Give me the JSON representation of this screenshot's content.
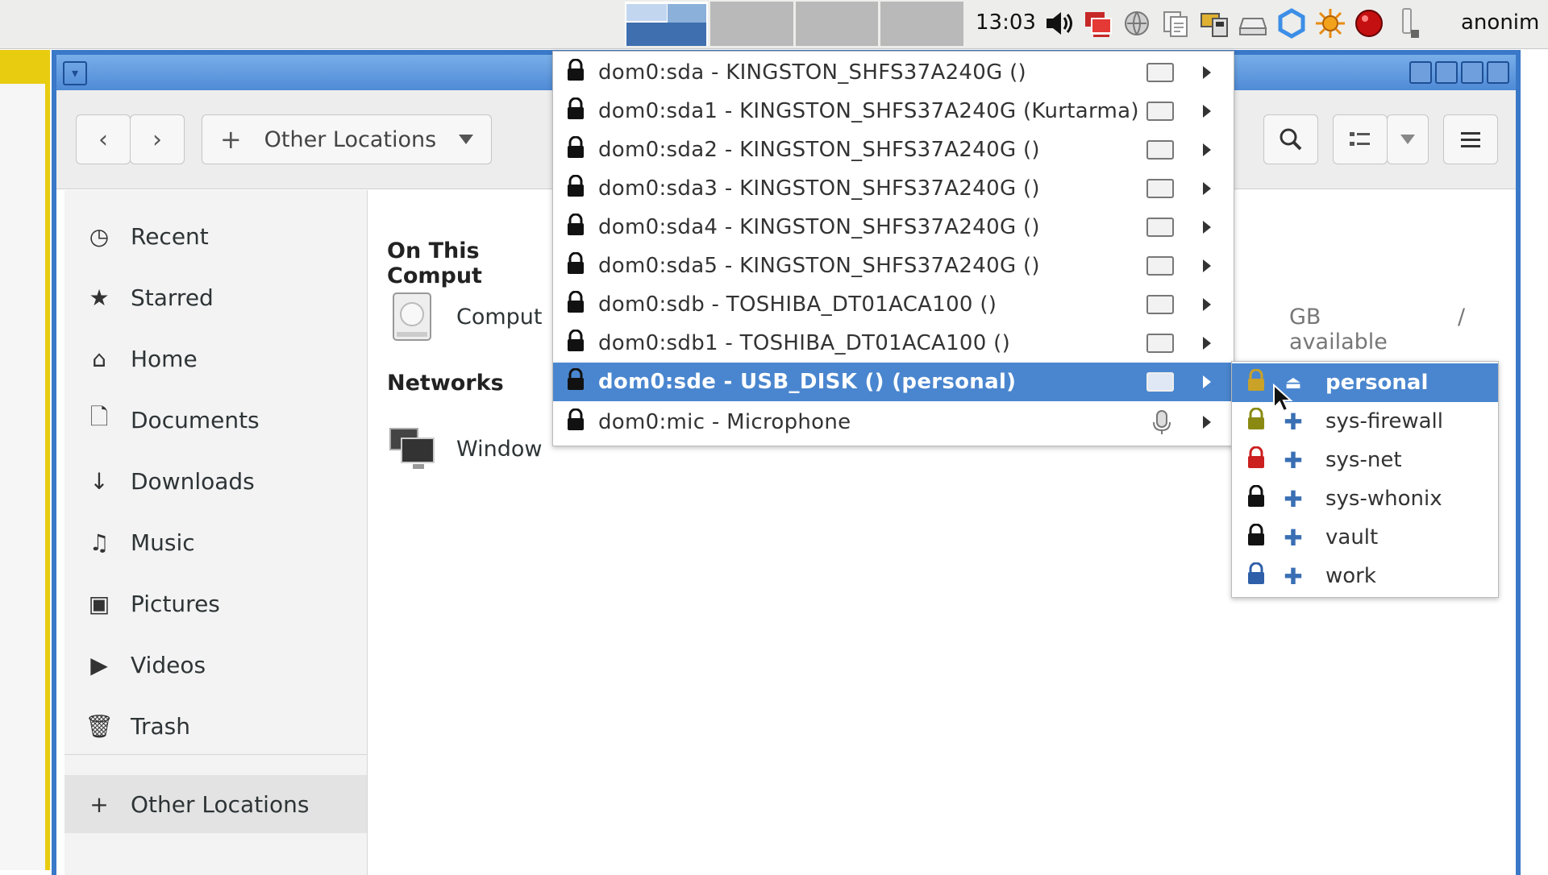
{
  "panel": {
    "clock": "13:03",
    "username": "anonim",
    "tray_icons": [
      "volume-icon",
      "qubes-domains-icon",
      "network-icon",
      "clipboard-icon",
      "devices-icon",
      "disk-icon",
      "updates-icon",
      "settings-sun-icon",
      "record-icon",
      "usb-icon"
    ]
  },
  "window": {
    "pathbar_label": "Other Locations"
  },
  "sidebar": {
    "items": [
      {
        "label": "Recent",
        "icon": "clock-icon"
      },
      {
        "label": "Starred",
        "icon": "star-icon"
      },
      {
        "label": "Home",
        "icon": "home-icon"
      },
      {
        "label": "Documents",
        "icon": "document-icon"
      },
      {
        "label": "Downloads",
        "icon": "download-icon"
      },
      {
        "label": "Music",
        "icon": "music-icon"
      },
      {
        "label": "Pictures",
        "icon": "camera-icon"
      },
      {
        "label": "Videos",
        "icon": "video-icon"
      },
      {
        "label": "Trash",
        "icon": "trash-icon"
      }
    ],
    "other_locations": "Other Locations"
  },
  "content": {
    "on_this_computer": "On This Comput",
    "computer_label": "Comput",
    "available": "GB available",
    "root": "/",
    "networks": "Networks",
    "windows_label": "Window"
  },
  "device_menu": {
    "items": [
      {
        "label": "dom0:sda - KINGSTON_SHFS37A240G ()",
        "kind": "drive"
      },
      {
        "label": "dom0:sda1 - KINGSTON_SHFS37A240G (Kurtarma)",
        "kind": "drive"
      },
      {
        "label": "dom0:sda2 - KINGSTON_SHFS37A240G ()",
        "kind": "drive"
      },
      {
        "label": "dom0:sda3 - KINGSTON_SHFS37A240G ()",
        "kind": "drive"
      },
      {
        "label": "dom0:sda4 - KINGSTON_SHFS37A240G ()",
        "kind": "drive"
      },
      {
        "label": "dom0:sda5 - KINGSTON_SHFS37A240G ()",
        "kind": "drive"
      },
      {
        "label": "dom0:sdb - TOSHIBA_DT01ACA100 ()",
        "kind": "drive"
      },
      {
        "label": "dom0:sdb1 - TOSHIBA_DT01ACA100 ()",
        "kind": "drive"
      },
      {
        "label": "dom0:sde - USB_DISK () (personal)",
        "kind": "drive",
        "highlighted": true
      },
      {
        "label": "dom0:mic - Microphone",
        "kind": "microphone"
      }
    ]
  },
  "vm_menu": {
    "items": [
      {
        "label": "personal",
        "lock_color": "#c9a227",
        "action": "eject",
        "highlighted": true
      },
      {
        "label": "sys-firewall",
        "lock_color": "#8a8a12",
        "action": "attach"
      },
      {
        "label": "sys-net",
        "lock_color": "#cc1f1f",
        "action": "attach"
      },
      {
        "label": "sys-whonix",
        "lock_color": "#111111",
        "action": "attach"
      },
      {
        "label": "vault",
        "lock_color": "#111111",
        "action": "attach"
      },
      {
        "label": "work",
        "lock_color": "#2e5fa8",
        "action": "attach"
      }
    ]
  },
  "colors": {
    "accent": "#4a86cf",
    "window_border": "#3a78c8",
    "background_window_border": "#e8cc10"
  }
}
